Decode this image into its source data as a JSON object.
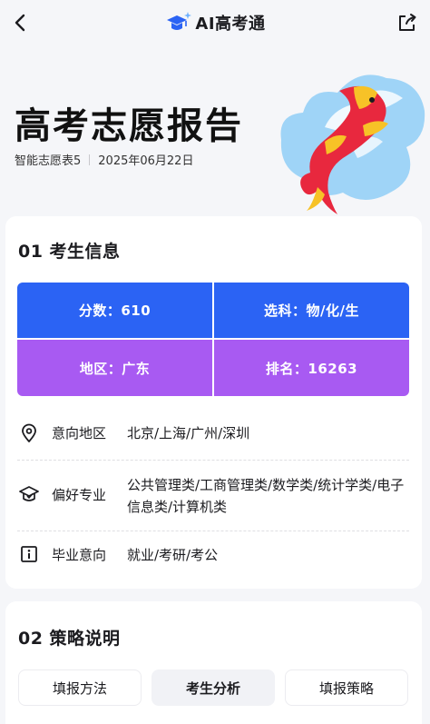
{
  "header": {
    "brand": "AI高考通"
  },
  "hero": {
    "title": "高考志愿报告",
    "table_name": "智能志愿表5",
    "date": "2025年06月22日"
  },
  "student_info": {
    "section_title": "01 考生信息",
    "score": "分数：610",
    "subjects": "选科：物/化/生",
    "region": "地区：广东",
    "rank": "排名：16263",
    "preferences": [
      {
        "label": "意向地区",
        "value": "北京/上海/广州/深圳",
        "icon": "location-pin-icon"
      },
      {
        "label": "偏好专业",
        "value": "公共管理类/工商管理类/数学类/统计学类/电子信息类/计算机类",
        "icon": "graduation-cap-icon"
      },
      {
        "label": "毕业意向",
        "value": "就业/考研/考公",
        "icon": "info-box-icon"
      }
    ]
  },
  "strategy": {
    "section_title": "02 策略说明",
    "tabs": [
      "填报方法",
      "考生分析",
      "填报策略"
    ],
    "active_tab": "考生分析"
  },
  "colors": {
    "blue_cell": "#2b63f4",
    "purple_cell": "#a85af2",
    "koi_red": "#e8283e",
    "koi_gold": "#f7c227",
    "koi_water": "#9fd4f7"
  }
}
